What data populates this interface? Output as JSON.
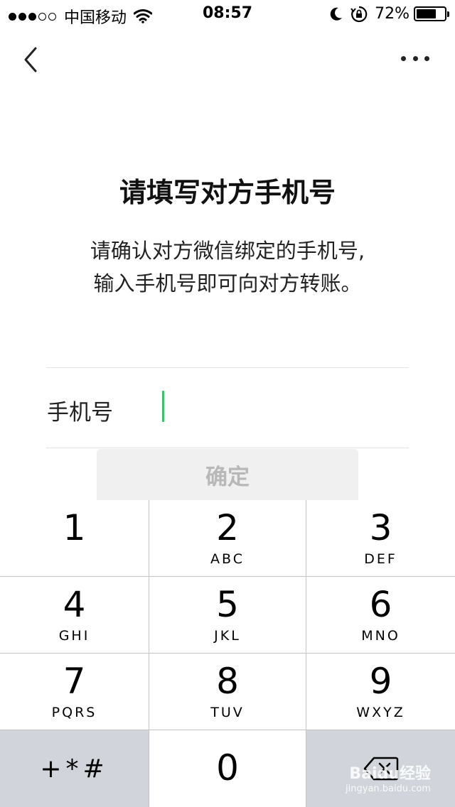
{
  "status_bar": {
    "carrier": "中国移动",
    "time": "08:57",
    "battery_percent_text": "72%",
    "battery_level": 0.72,
    "signal_strength": 3
  },
  "nav": {
    "back_icon": "chevron-left-icon",
    "more_icon": "more-horizontal-icon"
  },
  "content": {
    "title": "请填写对方手机号",
    "subtitle_line1": "请确认对方微信绑定的手机号,",
    "subtitle_line2": "输入手机号即可向对方转账。",
    "phone_label": "手机号",
    "phone_value": "",
    "confirm_label": "确定"
  },
  "keypad": {
    "keys": [
      {
        "digit": "1",
        "letters": ""
      },
      {
        "digit": "2",
        "letters": "ABC"
      },
      {
        "digit": "3",
        "letters": "DEF"
      },
      {
        "digit": "4",
        "letters": "GHI"
      },
      {
        "digit": "5",
        "letters": "JKL"
      },
      {
        "digit": "6",
        "letters": "MNO"
      },
      {
        "digit": "7",
        "letters": "PQRS"
      },
      {
        "digit": "8",
        "letters": "TUV"
      },
      {
        "digit": "9",
        "letters": "WXYZ"
      },
      {
        "digit": "0",
        "letters": ""
      }
    ],
    "symbols_label": "+*#",
    "delete_icon": "backspace-icon"
  },
  "watermark": {
    "brand": "Baidu经验",
    "url": "jingyan.baidu.com"
  },
  "colors": {
    "caret": "#3cbf6e",
    "keypad_gap": "#c4c4c4",
    "dark_key": "#d1d5db",
    "confirm_bg": "#f0f0f0",
    "confirm_text": "#b8b8b8"
  }
}
